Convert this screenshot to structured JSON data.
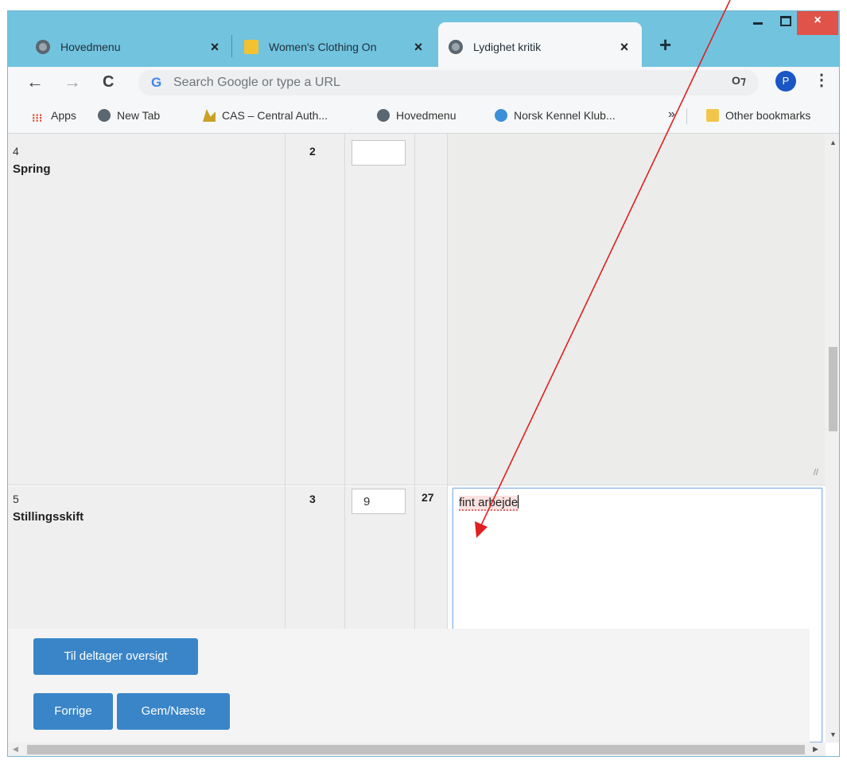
{
  "browser": {
    "tabs": [
      {
        "title": "Hovedmenu",
        "active": false
      },
      {
        "title": "Women's Clothing On",
        "active": false
      },
      {
        "title": "Lydighet kritik",
        "active": true
      }
    ],
    "close_glyph": "×",
    "new_tab_glyph": "+",
    "window_close_glyph": "×"
  },
  "toolbar": {
    "back": "←",
    "forward": "→",
    "reload": "C",
    "google_glyph": "G",
    "omnibox_placeholder": "Search Google or type a URL",
    "key_glyph": "O⁊",
    "avatar_letter": "P",
    "menu_glyph": "⋮"
  },
  "bookmarks": {
    "apps_glyph": "⁝⁝⁝",
    "items": [
      "Apps",
      "New Tab",
      "CAS – Central Auth...",
      "Hovedmenu",
      "Norsk Kennel Klub..."
    ],
    "more_glyph": "»",
    "other": "Other bookmarks"
  },
  "rows": [
    {
      "number": "4",
      "name": "Spring",
      "coefficient": "2",
      "score": "",
      "total": "",
      "comment": ""
    },
    {
      "number": "5",
      "name": "Stillingsskift",
      "coefficient": "3",
      "score": "9",
      "total": "27",
      "comment": "fint arbejde"
    }
  ],
  "buttons": {
    "overview": "Til deltager oversigt",
    "previous": "Forrige",
    "save_next": "Gem/Næste"
  },
  "colors": {
    "tabstrip": "#71c3de",
    "button": "#3a85c8",
    "annotation_arrow": "#e02020",
    "window_close": "#e0534a"
  }
}
